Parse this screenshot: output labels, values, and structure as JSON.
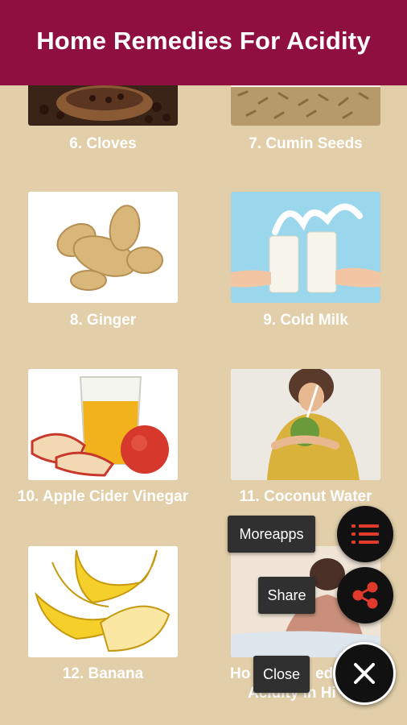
{
  "header": {
    "title": "Home Remedies For Acidity"
  },
  "remedies": [
    {
      "label": "6. Cloves"
    },
    {
      "label": "7. Cumin Seeds"
    },
    {
      "label": "8. Ginger"
    },
    {
      "label": "9. Cold Milk"
    },
    {
      "label": "10. Apple Cider Vinegar"
    },
    {
      "label": "11. Coconut Water"
    },
    {
      "label": "12. Banana"
    },
    {
      "label": "13. Home Remedies For Acidity in Hindi",
      "visible_fragment_1": "Ho",
      "visible_fragment_2": "ed",
      "visible_fragment_3": "Acidity in Hi"
    }
  ],
  "fab_menu": {
    "moreapps_label": "Moreapps",
    "share_label": "Share",
    "close_label": "Close"
  },
  "colors": {
    "header_bg": "#8f0f40",
    "page_bg": "#e2cfa9",
    "fab_icon": "#e03a2c"
  }
}
